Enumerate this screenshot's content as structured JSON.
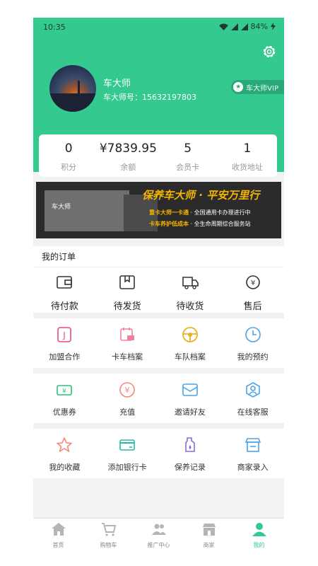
{
  "status_bar": {
    "time": "10:35",
    "battery": "84%"
  },
  "profile": {
    "name": "车大师",
    "id_label": "车大师号：15632197803",
    "vip_label": "车大师VIP"
  },
  "stats": [
    {
      "value": "0",
      "label": "积分"
    },
    {
      "value": "¥7839.95",
      "label": "余额"
    },
    {
      "value": "5",
      "label": "会员卡"
    },
    {
      "value": "1",
      "label": "收货地址"
    }
  ],
  "banner": {
    "logo_text": "车大师",
    "slogan": "保养车大师 · 平安万里行",
    "line1_key": "重卡大师一卡通",
    "line1_rest": "全国通用卡办理进行中",
    "line2_key": "卡车养护低成本",
    "line2_rest": "全生命周期综合服务站"
  },
  "orders": {
    "title": "我的订单",
    "items": [
      {
        "label": "待付款",
        "icon": "wallet-icon"
      },
      {
        "label": "待发货",
        "icon": "package-icon"
      },
      {
        "label": "待收货",
        "icon": "truck-icon"
      },
      {
        "label": "售后",
        "icon": "yen-refund-icon"
      }
    ]
  },
  "services": [
    [
      {
        "label": "加盟合作",
        "icon": "j-badge-icon"
      },
      {
        "label": "卡车档案",
        "icon": "truck-calendar-icon"
      },
      {
        "label": "车队档案",
        "icon": "steering-wheel-icon"
      },
      {
        "label": "我的预约",
        "icon": "clock-icon"
      }
    ],
    [
      {
        "label": "优惠券",
        "icon": "coupon-icon"
      },
      {
        "label": "充值",
        "icon": "yen-circle-icon"
      },
      {
        "label": "邀请好友",
        "icon": "invite-envelope-icon"
      },
      {
        "label": "在线客服",
        "icon": "service-agent-icon"
      }
    ],
    [
      {
        "label": "我的收藏",
        "icon": "star-icon"
      },
      {
        "label": "添加银行卡",
        "icon": "bank-card-icon"
      },
      {
        "label": "保养记录",
        "icon": "oil-bottle-icon"
      },
      {
        "label": "商家录入",
        "icon": "shop-register-icon"
      }
    ]
  ],
  "tabbar": [
    {
      "label": "首页",
      "icon": "home-icon"
    },
    {
      "label": "购物车",
      "icon": "cart-icon"
    },
    {
      "label": "推广中心",
      "icon": "people-icon"
    },
    {
      "label": "商家",
      "icon": "store-icon"
    },
    {
      "label": "我的",
      "icon": "person-icon",
      "active": true
    }
  ],
  "colors": {
    "brand_green": "#33c98f",
    "tab_active": "#33c98f"
  }
}
